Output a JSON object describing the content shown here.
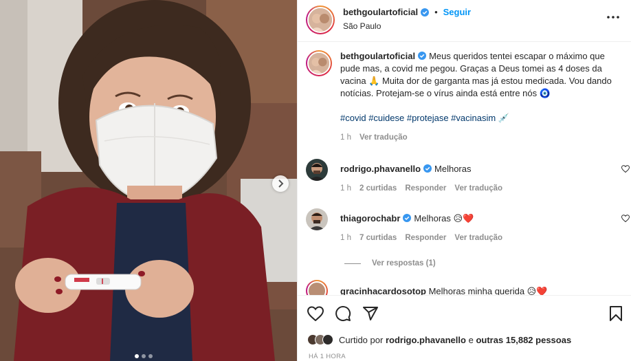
{
  "post": {
    "carousel": {
      "dots": 3,
      "active_index": 0
    }
  },
  "header": {
    "username": "bethgoulartoficial",
    "separator": "•",
    "follow_label": "Seguir",
    "location": "São Paulo"
  },
  "caption": {
    "username": "bethgoulartoficial",
    "text": "Meus queridos tentei escapar o máximo que pude mas, a covid me pegou. Graças a Deus tomei as 4 doses da vacina 🙏 Muita dor de garganta mas já estou medicada. Vou dando notícias. Protejam-se o vírus ainda está entre nós 🧿",
    "hashtags": "#covid #cuidese #protejase #vacinasim 💉",
    "time": "1 h",
    "translate": "Ver tradução"
  },
  "comments": [
    {
      "username": "rodrigo.phavanello",
      "text": "Melhoras",
      "time": "1 h",
      "likes": "2 curtidas",
      "reply": "Responder",
      "translate": "Ver tradução"
    },
    {
      "username": "thiagorochabr",
      "text": "Melhoras 😥❤️",
      "time": "1 h",
      "likes": "7 curtidas",
      "reply": "Responder",
      "translate": "Ver tradução",
      "view_replies": "Ver respostas (1)"
    },
    {
      "username": "gracinhacardosotop",
      "text": "Melhoras minha querida 😥❤️"
    }
  ],
  "likes": {
    "prefix": "Curtido por",
    "user": "rodrigo.phavanello",
    "conj": "e",
    "others": "outras 15,882 pessoas"
  },
  "timestamp": "HÁ 1 HORA",
  "icons": {
    "like": "heart-icon",
    "comment": "comment-icon",
    "share": "send-icon",
    "save": "bookmark-icon",
    "more": "more-horizontal-icon",
    "verified": "verified-badge-icon",
    "next": "chevron-right-icon"
  },
  "colors": {
    "accent": "#0095f6",
    "verified": "#3897f0",
    "hashtag": "#00376b",
    "muted": "#8e8e8e"
  }
}
